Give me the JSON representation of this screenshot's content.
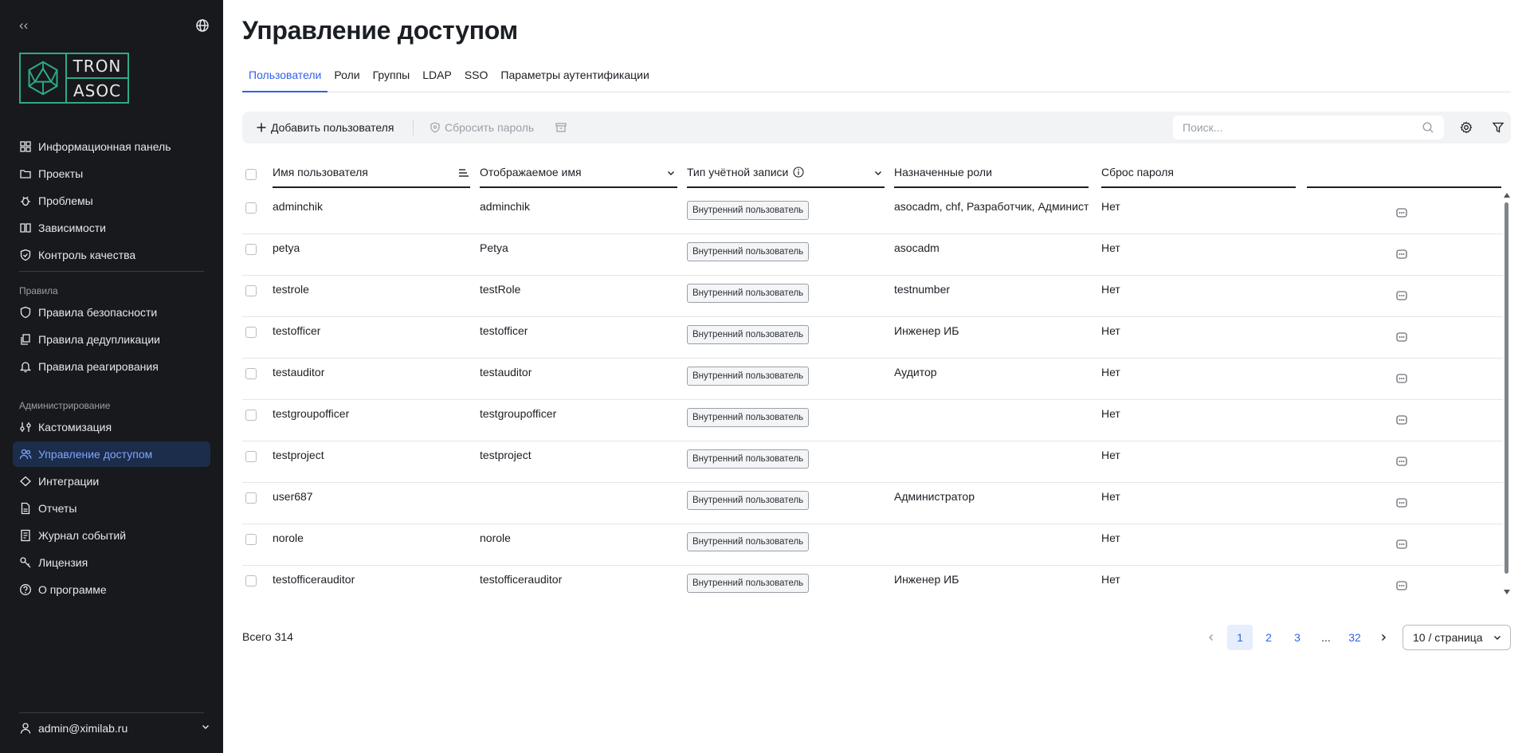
{
  "sidebar": {
    "logo": {
      "line1": "TRON",
      "line2": "ASOC",
      "color": "#2fa98a"
    },
    "items_main": [
      {
        "label": "Информационная панель",
        "icon": "dashboard-icon"
      },
      {
        "label": "Проекты",
        "icon": "folder-icon"
      },
      {
        "label": "Проблемы",
        "icon": "bug-icon"
      },
      {
        "label": "Зависимости",
        "icon": "book-icon"
      },
      {
        "label": "Контроль качества",
        "icon": "shield-check-icon"
      }
    ],
    "section_rules": "Правила",
    "items_rules": [
      {
        "label": "Правила безопасности",
        "icon": "shield-icon"
      },
      {
        "label": "Правила дедупликации",
        "icon": "copy-icon"
      },
      {
        "label": "Правила реагирования",
        "icon": "bell-icon"
      }
    ],
    "section_admin": "Администрирование",
    "items_admin": [
      {
        "label": "Кастомизация",
        "icon": "sliders-icon"
      },
      {
        "label": "Управление доступом",
        "icon": "users-icon",
        "active": true
      },
      {
        "label": "Интеграции",
        "icon": "integration-icon"
      },
      {
        "label": "Отчеты",
        "icon": "report-icon"
      },
      {
        "label": "Журнал событий",
        "icon": "journal-icon"
      },
      {
        "label": "Лицензия",
        "icon": "key-icon"
      },
      {
        "label": "О программе",
        "icon": "help-icon"
      }
    ],
    "user": "admin@ximilab.ru"
  },
  "page": {
    "title": "Управление доступом",
    "tabs": [
      "Пользователи",
      "Роли",
      "Группы",
      "LDAP",
      "SSO",
      "Параметры аутентификации"
    ],
    "active_tab": 0
  },
  "toolbar": {
    "add_user": "Добавить пользователя",
    "reset_password": "Сбросить пароль",
    "search_placeholder": "Поиск..."
  },
  "table": {
    "columns": [
      "Имя пользователя",
      "Отображаемое имя",
      "Тип учётной записи",
      "Назначенные роли",
      "Сброс пароля"
    ],
    "rows": [
      {
        "username": "adminchik",
        "display": "adminchik",
        "type": "Внутренний пользователь",
        "roles": "asocadm, chf, Разработчик, Администратор",
        "reset": "Нет"
      },
      {
        "username": "petya",
        "display": "Petya",
        "type": "Внутренний пользователь",
        "roles": "asocadm",
        "reset": "Нет"
      },
      {
        "username": "testrole",
        "display": "testRole",
        "type": "Внутренний пользователь",
        "roles": "testnumber",
        "reset": "Нет"
      },
      {
        "username": "testofficer",
        "display": "testofficer",
        "type": "Внутренний пользователь",
        "roles": "Инженер ИБ",
        "reset": "Нет"
      },
      {
        "username": "testauditor",
        "display": "testauditor",
        "type": "Внутренний пользователь",
        "roles": "Аудитор",
        "reset": "Нет"
      },
      {
        "username": "testgroupofficer",
        "display": "testgroupofficer",
        "type": "Внутренний пользователь",
        "roles": "",
        "reset": "Нет"
      },
      {
        "username": "testproject",
        "display": "testproject",
        "type": "Внутренний пользователь",
        "roles": "",
        "reset": "Нет"
      },
      {
        "username": "user687",
        "display": "",
        "type": "Внутренний пользователь",
        "roles": "Администратор",
        "reset": "Нет"
      },
      {
        "username": "norole",
        "display": "norole",
        "type": "Внутренний пользователь",
        "roles": "",
        "reset": "Нет"
      },
      {
        "username": "testofficerauditor",
        "display": "testofficerauditor",
        "type": "Внутренний пользователь",
        "roles": "Инженер ИБ",
        "reset": "Нет"
      }
    ]
  },
  "footer": {
    "total": "Всего 314",
    "pages": [
      "1",
      "2",
      "3",
      "...",
      "32"
    ],
    "current_page": "1",
    "page_size": "10 / страница"
  },
  "colors": {
    "accent": "#2f62e8",
    "sidebar_bg": "#17191c",
    "active_bg": "#1c2c4b"
  }
}
